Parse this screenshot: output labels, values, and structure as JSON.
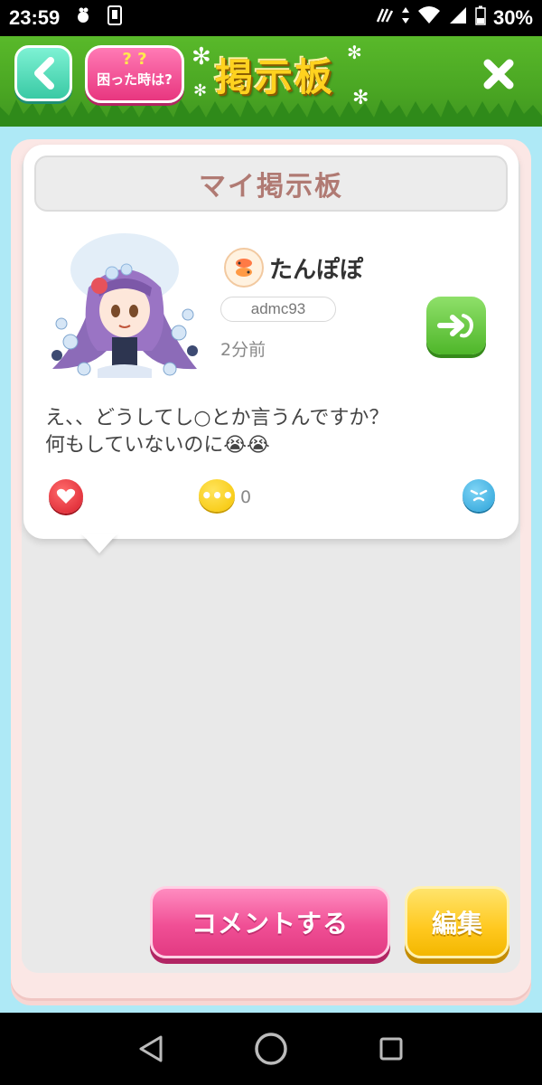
{
  "status_bar": {
    "time": "23:59",
    "battery": "30%",
    "icons": [
      "app-notification-icon",
      "sim-icon",
      "nfc-icon",
      "data-arrows-icon",
      "wifi-icon",
      "signal-icon",
      "battery-icon"
    ]
  },
  "header": {
    "back_icon": "chevron-left-icon",
    "help_label": "困った時は?",
    "help_marks": "? ?",
    "title": "掲示板",
    "close_icon": "close-icon"
  },
  "board": {
    "title": "マイ掲示板"
  },
  "post": {
    "username": "たんぽぽ",
    "user_id": "admc93",
    "time_ago": "2分前",
    "message_line1": "え、、どうしてし○とか言うんですか？",
    "message_line2": "何もしていないのに😭😭",
    "comment_count": "0",
    "zodiac_icon": "pisces-icon",
    "visit_icon": "visit-arrow-icon",
    "like_icon": "heart-icon",
    "comment_icon": "speech-bubble-icon",
    "report_icon": "angry-face-icon"
  },
  "actions": {
    "comment_label": "コメントする",
    "edit_label": "編集"
  },
  "colors": {
    "header_green": "#4aa623",
    "sky": "#aee9f6",
    "pink_button": "#f04f95",
    "yellow_button": "#ffc81e",
    "title_text": "#b07a73"
  }
}
